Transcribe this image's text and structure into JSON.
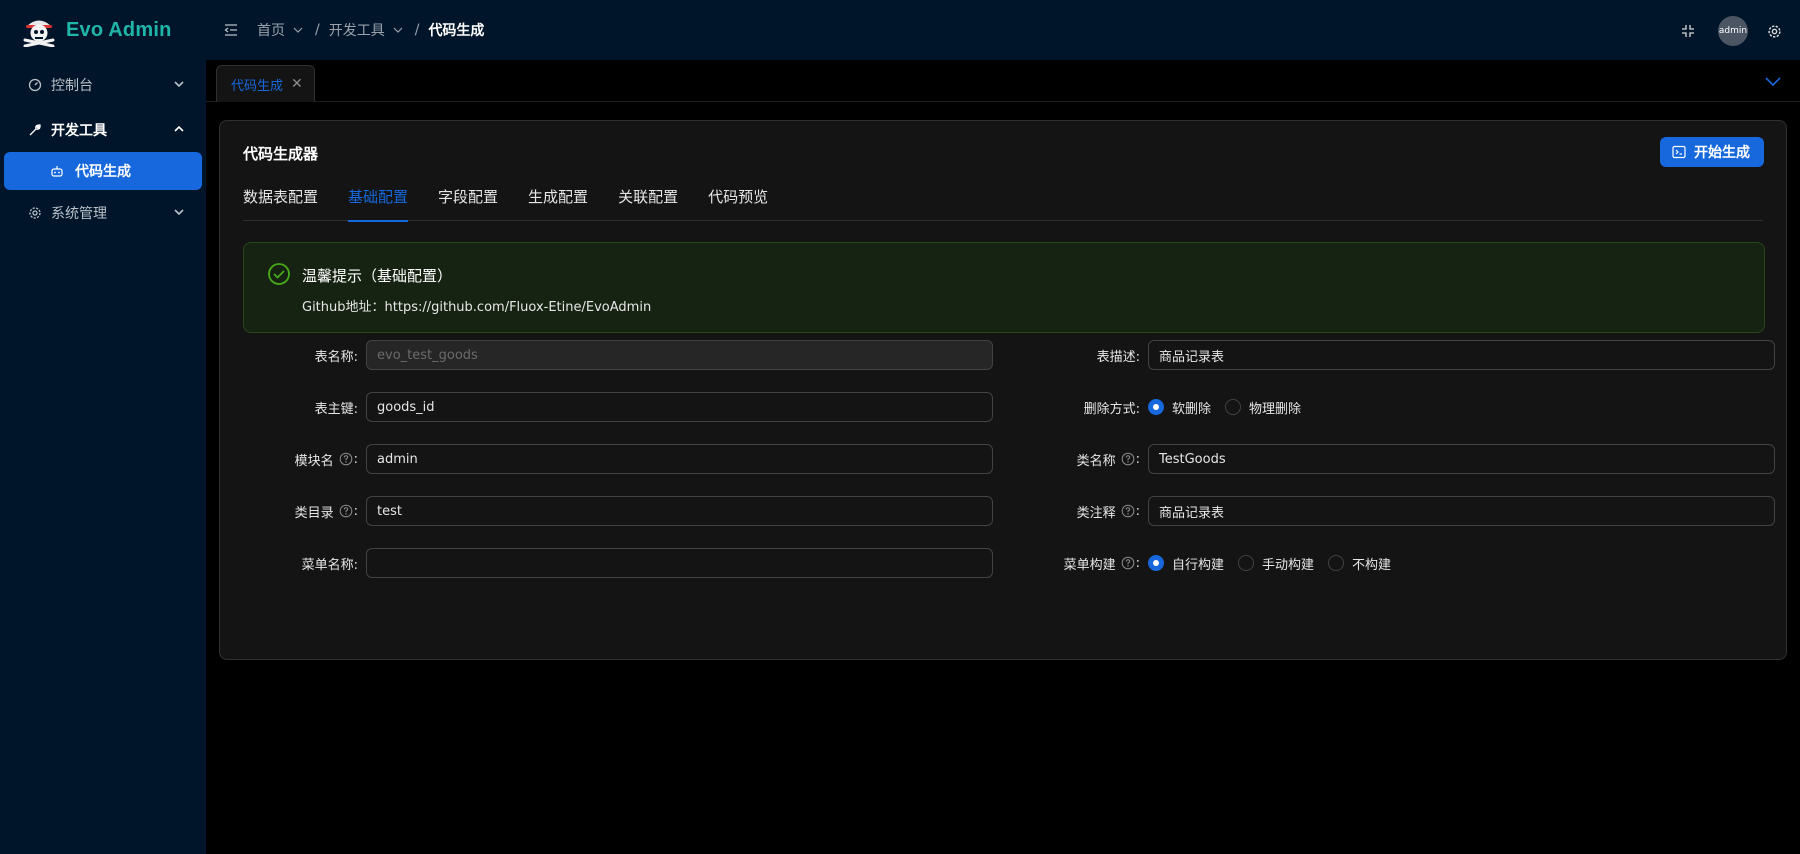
{
  "app": {
    "title": "Evo Admin"
  },
  "sidebar": {
    "items": [
      {
        "label": "控制台",
        "icon": "dashboard-icon"
      },
      {
        "label": "开发工具",
        "icon": "tool-icon"
      },
      {
        "label": "系统管理",
        "icon": "gear-icon"
      }
    ],
    "active_sub": {
      "label": "代码生成",
      "icon": "robot-icon"
    }
  },
  "header": {
    "breadcrumb": [
      "首页",
      "开发工具",
      "代码生成"
    ],
    "avatar_text": "admin"
  },
  "page_tab": {
    "label": "代码生成"
  },
  "card": {
    "title": "代码生成器",
    "generate_button": "开始生成",
    "tabs": [
      "数据表配置",
      "基础配置",
      "字段配置",
      "生成配置",
      "关联配置",
      "代码预览"
    ],
    "active_tab": "基础配置"
  },
  "alert": {
    "title": "温馨提示（基础配置）",
    "description": "Github地址：https://github.com/Fluox-Etine/EvoAdmin"
  },
  "form": {
    "table_name": {
      "label": "表名称:",
      "value": "evo_test_goods"
    },
    "table_desc": {
      "label": "表描述:",
      "value": "商品记录表"
    },
    "primary_key": {
      "label": "表主键:",
      "value": "goods_id"
    },
    "delete_mode": {
      "label": "删除方式:",
      "options": [
        "软删除",
        "物理删除"
      ],
      "selected": "软删除"
    },
    "module_name": {
      "label": "模块名",
      "suffix": ":",
      "value": "admin"
    },
    "class_name": {
      "label": "类名称",
      "suffix": ":",
      "value": "TestGoods"
    },
    "class_dir": {
      "label": "类目录",
      "suffix": ":",
      "value": "test"
    },
    "class_comment": {
      "label": "类注释",
      "suffix": ":",
      "value": "商品记录表"
    },
    "menu_name": {
      "label": "菜单名称:",
      "value": ""
    },
    "menu_build": {
      "label": "菜单构建",
      "suffix": ":",
      "options": [
        "自行构建",
        "手动构建",
        "不构建"
      ],
      "selected": "自行构建"
    }
  },
  "colors": {
    "primary": "#1668dc",
    "sidebar_bg": "#001529",
    "success": "#49aa19",
    "logo_text": "#1fb5a8"
  }
}
